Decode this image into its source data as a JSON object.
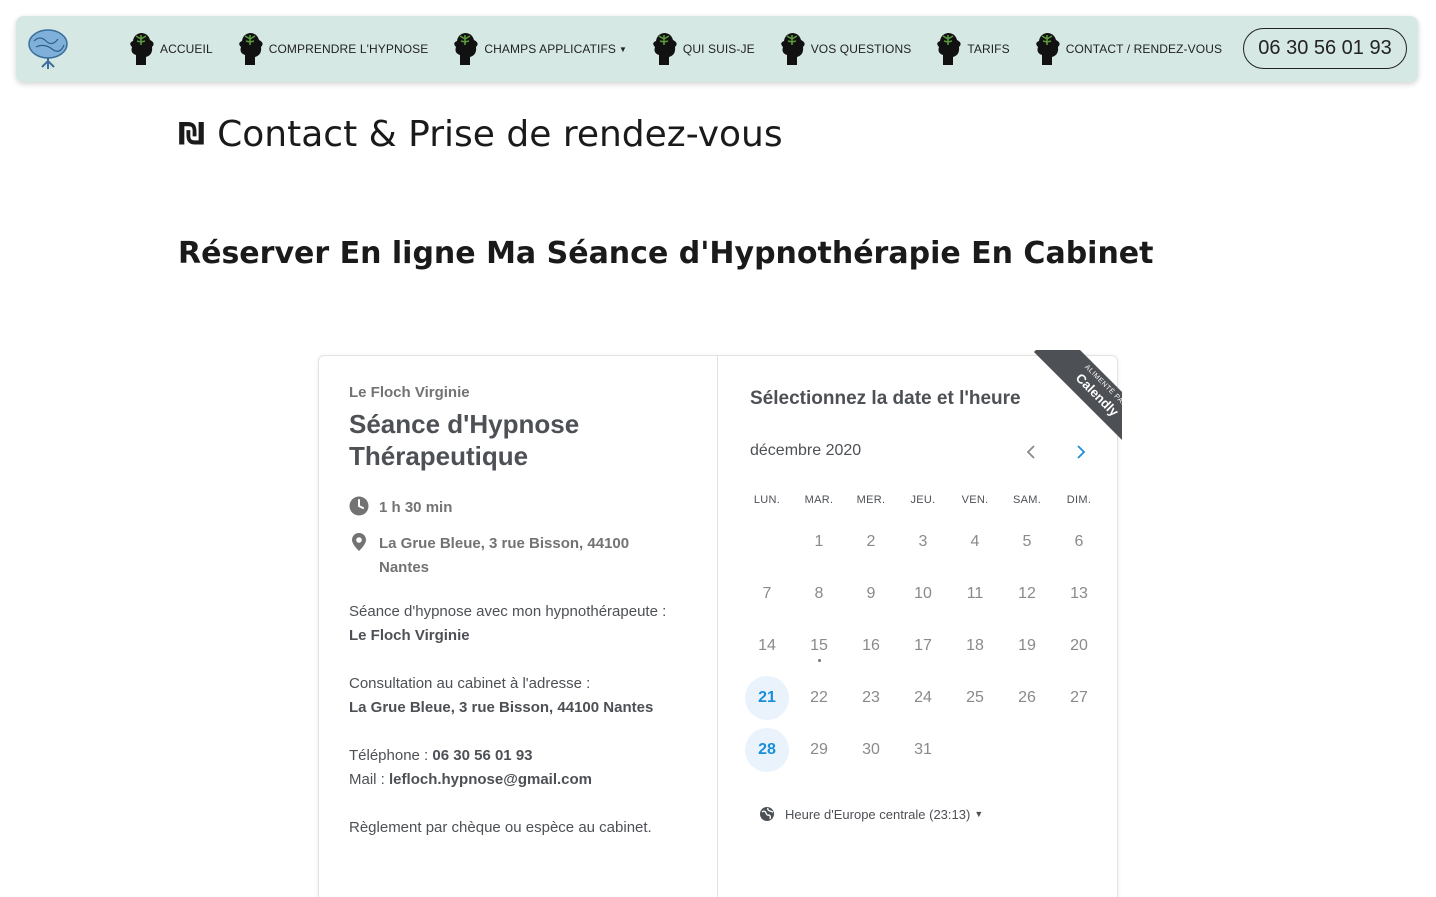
{
  "nav": {
    "items": [
      {
        "label": "ACCUEIL",
        "dropdown": false
      },
      {
        "label": "COMPRENDRE L'HYPNOSE",
        "dropdown": false
      },
      {
        "label": "CHAMPS APPLICATIFS",
        "dropdown": true
      },
      {
        "label": "QUI SUIS-JE",
        "dropdown": false
      },
      {
        "label": "VOS QUESTIONS",
        "dropdown": false
      },
      {
        "label": "TARIFS",
        "dropdown": false
      },
      {
        "label": "CONTACT / RENDEZ-VOUS",
        "dropdown": false
      }
    ],
    "phone": "06 30 56 01 93"
  },
  "page": {
    "title_icon": "₪",
    "title": "Contact & Prise de rendez-vous",
    "subtitle": "Réserver En ligne Ma Séance d'Hypnothérapie En Cabinet"
  },
  "widget": {
    "organizer": "Le Floch Virginie",
    "event_name": "Séance d'Hypnose Thérapeutique",
    "duration": "1 h 30 min",
    "location": "La Grue Bleue, 3 rue Bisson, 44100 Nantes",
    "desc1_text": "Séance d'hypnose avec mon hypnothérapeute :",
    "desc1_bold": "Le Floch Virginie",
    "desc2_text": "Consultation au cabinet à l'adresse :",
    "desc2_bold": "La Grue Bleue, 3 rue Bisson, 44100 Nantes",
    "phone_label": "Téléphone : ",
    "phone_value": "06 30 56 01 93",
    "mail_label": "Mail : ",
    "mail_value": "lefloch.hypnose@gmail.com",
    "payment": "Règlement par chèque ou espèce au cabinet.",
    "select_title": "Sélectionnez la date et l'heure",
    "month": "décembre 2020",
    "weekdays": [
      "LUN.",
      "MAR.",
      "MER.",
      "JEU.",
      "VEN.",
      "SAM.",
      "DIM."
    ],
    "first_day_offset": 1,
    "days_in_month": 31,
    "available_days": [
      21,
      28
    ],
    "today": 15,
    "timezone": "Heure d'Europe centrale (23:13)",
    "ribbon_small": "ALIMENTÉ PAR",
    "ribbon_brand": "Calendly"
  },
  "colors": {
    "navbar_bg": "#d5e8e3",
    "accent": "#1a8fd9",
    "ribbon": "#4d5055"
  },
  "icons": {
    "logo": "brain-tree-icon",
    "nav": "head-tree-icon",
    "duration": "clock-icon",
    "location": "map-pin-icon",
    "timezone": "globe-icon",
    "prev": "chevron-left-icon",
    "next": "chevron-right-icon"
  }
}
